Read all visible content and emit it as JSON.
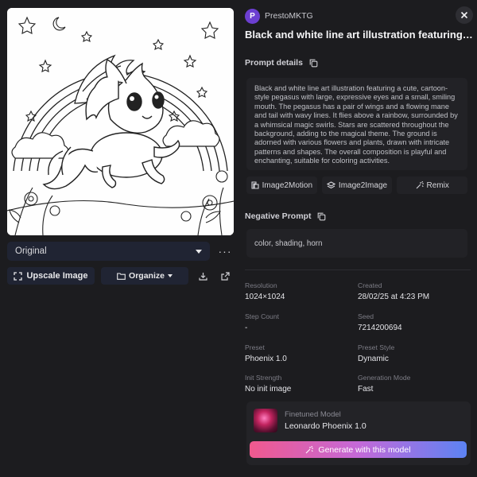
{
  "left": {
    "version_select": "Original",
    "upscale_label": "Upscale Image",
    "organize_label": "Organize"
  },
  "header": {
    "avatar_letter": "P",
    "username": "PrestoMKTG",
    "title": "Black and white line art illustration featuring a..."
  },
  "prompt": {
    "label": "Prompt details",
    "text": "Black and white line art illustration featuring a cute, cartoon-style pegasus with large, expressive eyes and a small, smiling mouth. The pegasus has a pair of wings and a flowing mane and tail with wavy lines. It flies above a rainbow, surrounded by a whimsical magic swirls. Stars are scattered throughout the background, adding to the magical theme. The ground is adorned with various flowers and plants, drawn with intricate patterns and shapes. The overall composition is playful and enchanting, suitable for coloring activities."
  },
  "actions": {
    "image2motion": "Image2Motion",
    "image2image": "Image2Image",
    "remix": "Remix"
  },
  "negative": {
    "label": "Negative Prompt",
    "text": "color, shading, horn"
  },
  "meta": {
    "resolution_k": "Resolution",
    "resolution_v": "1024×1024",
    "created_k": "Created",
    "created_v": "28/02/25 at 4:23 PM",
    "steps_k": "Step Count",
    "steps_v": "-",
    "seed_k": "Seed",
    "seed_v": "7214200694",
    "preset_k": "Preset",
    "preset_v": "Phoenix 1.0",
    "preset_style_k": "Preset Style",
    "preset_style_v": "Dynamic",
    "init_k": "Init Strength",
    "init_v": "No init image",
    "genmode_k": "Generation Mode",
    "genmode_v": "Fast"
  },
  "model": {
    "kicker": "Finetuned Model",
    "name": "Leonardo Phoenix 1.0",
    "generate_label": "Generate with this model"
  },
  "colors": {
    "background": "#1c1c1f",
    "panel": "#222226",
    "avatar": "#6c3fd1",
    "gradient_start": "#f0598e",
    "gradient_end": "#5c83f4"
  }
}
